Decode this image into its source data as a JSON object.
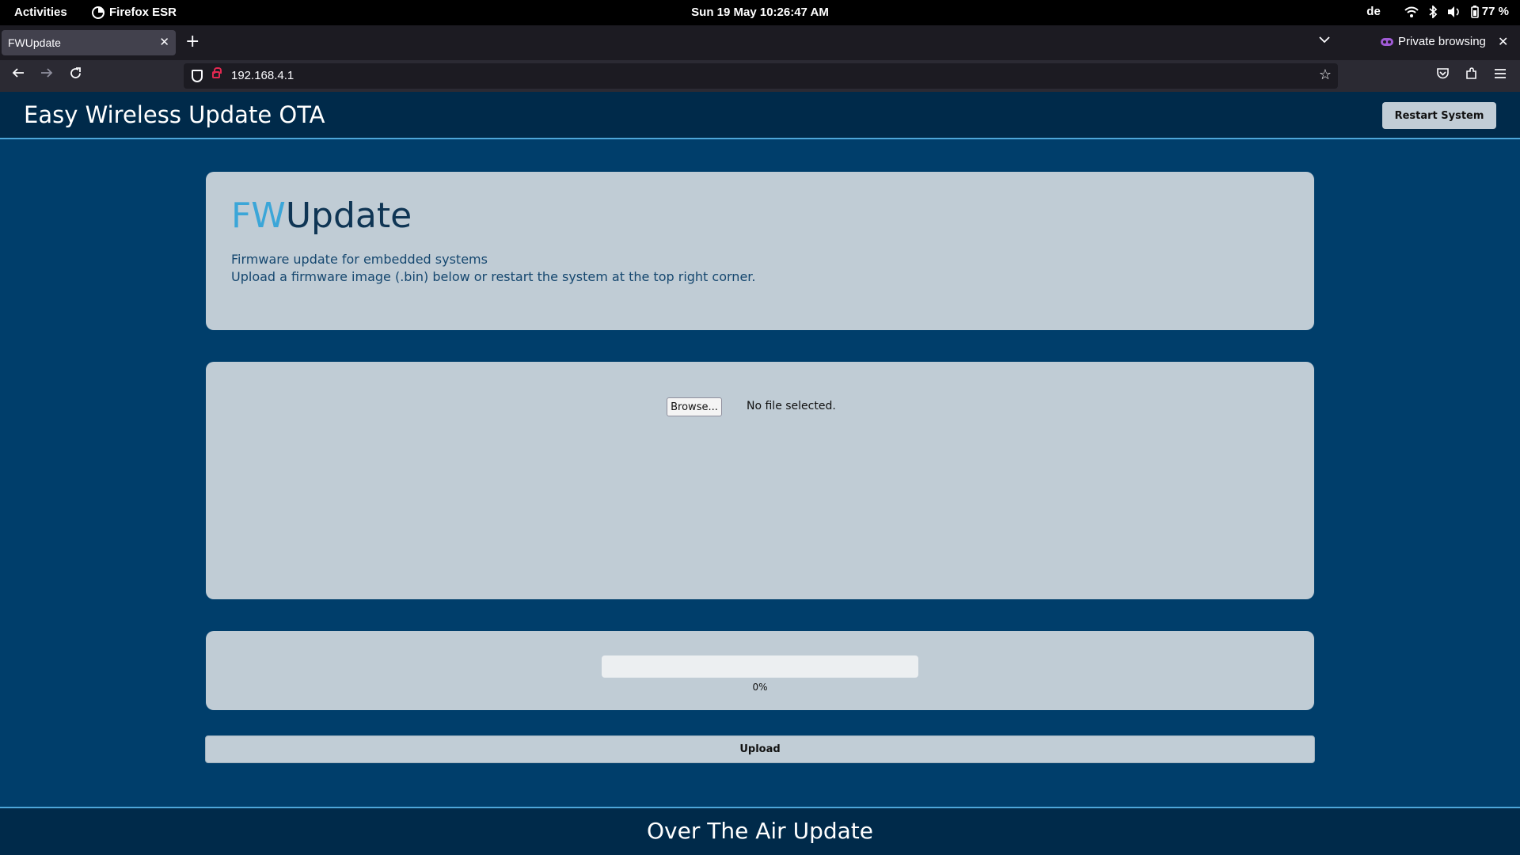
{
  "system_bar": {
    "activities": "Activities",
    "app_name": "Firefox ESR",
    "datetime": "Sun 19 May  10:26:47 AM",
    "keyboard_layout": "de",
    "battery": "77 %"
  },
  "browser": {
    "tab_title": "FWUpdate",
    "private_label": "Private browsing",
    "url": "192.168.4.1"
  },
  "page": {
    "header_title": "Easy Wireless Update OTA",
    "restart_label": "Restart System",
    "fw_prefix": "FW",
    "fw_suffix": "Update",
    "desc_line1": "Firmware update for embedded systems",
    "desc_line2": "Upload a firmware image (.bin) below or restart the system at the top right corner.",
    "browse_label": "Browse...",
    "file_status": "No file selected.",
    "progress_percent": 0,
    "progress_text": "0%",
    "upload_label": "Upload",
    "footer_text": "Over The Air Update"
  },
  "colors": {
    "page_bg": "#003e6b",
    "header_bg": "#002a4a",
    "accent": "#3ba6d8",
    "card_bg": "#c0ccd5",
    "title_dark": "#0f3554"
  }
}
